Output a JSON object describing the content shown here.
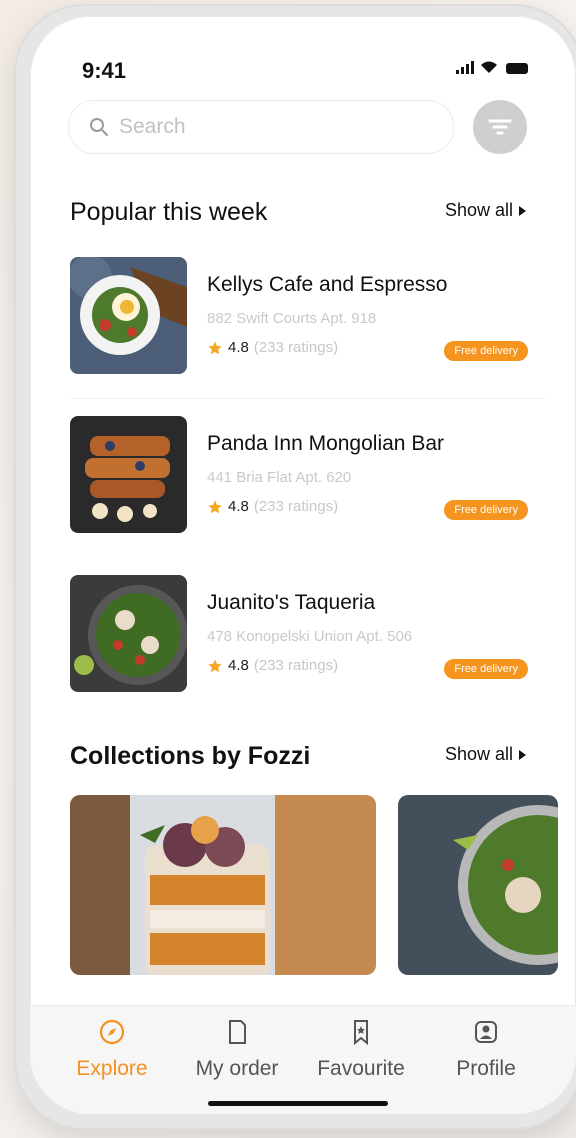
{
  "status_bar": {
    "time": "9:41"
  },
  "search": {
    "placeholder": "Search"
  },
  "popular": {
    "title": "Popular this week",
    "show_all": "Show all",
    "items": [
      {
        "name": "Kellys Cafe and Espresso",
        "address": "882 Swift Courts Apt. 918",
        "rating": "4.8",
        "ratings_count": "(233 ratings)",
        "badge": "Free delivery"
      },
      {
        "name": "Panda Inn Mongolian Bar",
        "address": "441 Bria Flat Apt. 620",
        "rating": "4.8",
        "ratings_count": "(233 ratings)",
        "badge": "Free delivery"
      },
      {
        "name": "Juanito's Taqueria",
        "address": "478 Konopelski Union Apt. 506",
        "rating": "4.8",
        "ratings_count": "(233 ratings)",
        "badge": "Free delivery"
      }
    ]
  },
  "collections": {
    "title": "Collections by Fozzi",
    "show_all": "Show all"
  },
  "tabs": [
    {
      "label": "Explore",
      "icon": "compass-icon",
      "active": true
    },
    {
      "label": "My order",
      "icon": "document-icon",
      "active": false
    },
    {
      "label": "Favourite",
      "icon": "bookmark-icon",
      "active": false
    },
    {
      "label": "Profile",
      "icon": "profile-icon",
      "active": false
    }
  ],
  "colors": {
    "accent": "#f39122",
    "badge": "#f5941e",
    "filter_bg": "#cfcfcf"
  }
}
